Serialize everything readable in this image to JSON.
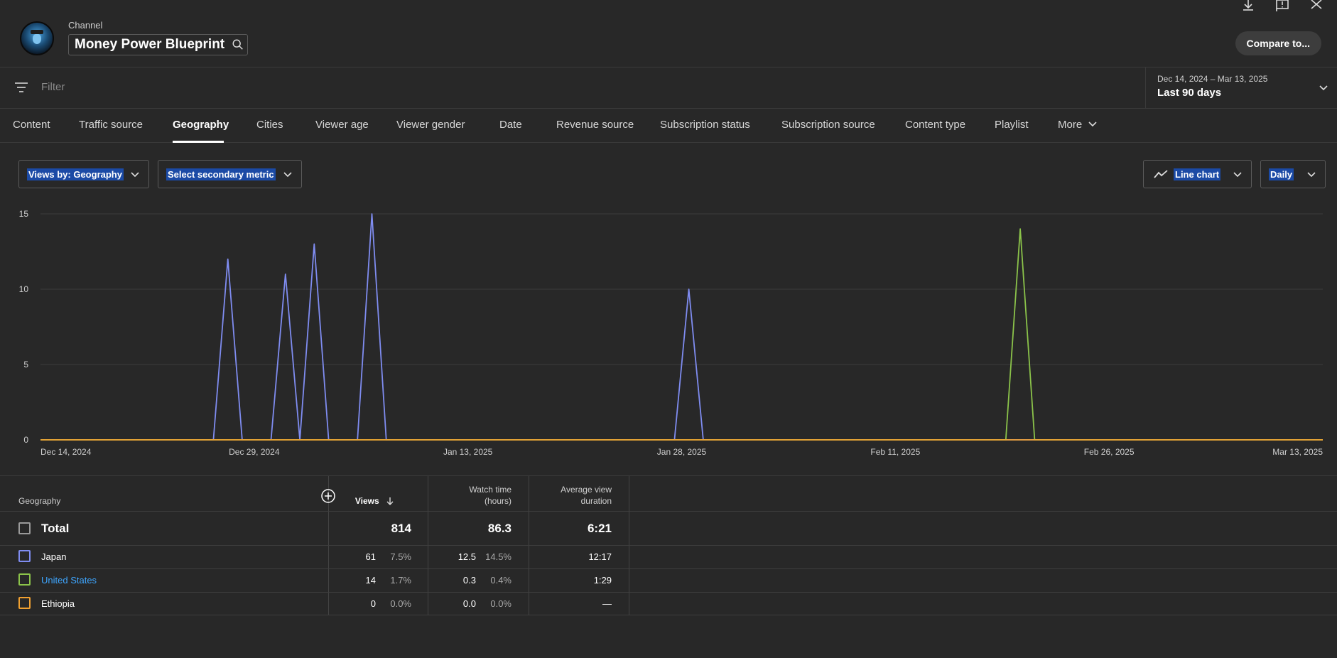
{
  "header": {
    "channel_label": "Channel",
    "channel_name": "Money Power Blueprint",
    "compare_label": "Compare to...",
    "icons": [
      "download-icon",
      "feedback-icon",
      "close-icon"
    ]
  },
  "filter": {
    "placeholder": "Filter",
    "date_range": "Dec 14, 2024 – Mar 13, 2025",
    "period_label": "Last 90 days"
  },
  "tabs": [
    "Content",
    "Traffic source",
    "Geography",
    "Cities",
    "Viewer age",
    "Viewer gender",
    "Date",
    "Revenue source",
    "Subscription status",
    "Subscription source",
    "Content type",
    "Playlist",
    "More"
  ],
  "active_tab": "Geography",
  "controls": {
    "primary_metric": "Views by: Geography",
    "secondary_metric": "Select secondary metric",
    "chart_type": "Line chart",
    "interval": "Daily"
  },
  "chart_data": {
    "type": "line",
    "x_labels": [
      "Dec 14, 2024",
      "Dec 29, 2024",
      "Jan 13, 2025",
      "Jan 28, 2025",
      "Feb 11, 2025",
      "Feb 26, 2025",
      "Mar 13, 2025"
    ],
    "y_ticks": [
      0,
      5,
      10,
      15
    ],
    "ylim": [
      0,
      15
    ],
    "x_range": [
      "2024-12-14",
      "2025-03-13"
    ],
    "grid": true,
    "series": [
      {
        "name": "Japan",
        "color": "#7f8cf0",
        "points": [
          {
            "x": "2024-12-27",
            "y": 12
          },
          {
            "x": "2024-12-31",
            "y": 11
          },
          {
            "x": "2025-01-02",
            "y": 13
          },
          {
            "x": "2025-01-06",
            "y": 15
          },
          {
            "x": "2025-01-28",
            "y": 10
          }
        ]
      },
      {
        "name": "United States",
        "color": "#8bc34a",
        "points": [
          {
            "x": "2025-02-20",
            "y": 14
          }
        ]
      },
      {
        "name": "Ethiopia",
        "color": "#f0a030",
        "points": []
      }
    ]
  },
  "table": {
    "headers": {
      "geography": "Geography",
      "views": "Views",
      "watch_time_l1": "Watch time",
      "watch_time_l2": "(hours)",
      "avg_l1": "Average view",
      "avg_l2": "duration"
    },
    "total": {
      "name": "Total",
      "views": "814",
      "watch": "86.3",
      "avg": "6:21"
    },
    "rows": [
      {
        "name": "Japan",
        "views": "61",
        "views_pct": "7.5%",
        "watch": "12.5",
        "watch_pct": "14.5%",
        "avg": "12:17",
        "color": "#7f8cf0"
      },
      {
        "name": "United States",
        "views": "14",
        "views_pct": "1.7%",
        "watch": "0.3",
        "watch_pct": "0.4%",
        "avg": "1:29",
        "color": "#8bc34a"
      },
      {
        "name": "Ethiopia",
        "views": "0",
        "views_pct": "0.0%",
        "watch": "0.0",
        "watch_pct": "0.0%",
        "avg": "—",
        "color": "#f0a030"
      }
    ]
  }
}
